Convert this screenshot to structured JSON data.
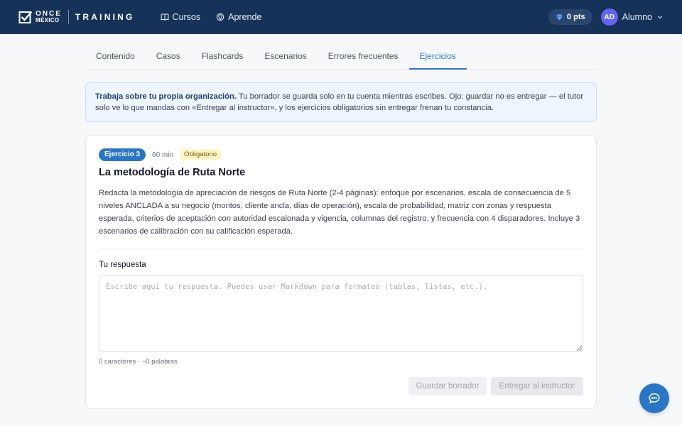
{
  "header": {
    "logo_top": "ONCE",
    "logo_bottom": "MÉXICO",
    "brand": "TRAINING",
    "nav": [
      {
        "label": "Cursos",
        "icon": "book-open-icon"
      },
      {
        "label": "Aprende",
        "icon": "lightbulb-icon"
      }
    ],
    "points": "0 pts",
    "avatar_initials": "AD",
    "user_name": "Alumno"
  },
  "tabs": [
    {
      "label": "Contenido",
      "active": false
    },
    {
      "label": "Casos",
      "active": false
    },
    {
      "label": "Flashcards",
      "active": false
    },
    {
      "label": "Escenarios",
      "active": false
    },
    {
      "label": "Errores frecuentes",
      "active": false
    },
    {
      "label": "Ejercicios",
      "active": true
    }
  ],
  "notice": {
    "bold": "Trabaja sobre tu propia organización.",
    "text": " Tu borrador se guarda solo en tu cuenta mientras escribes. Ojo: guardar no es entregar — el tutor solo ve lo que mandas con «Entregar al instructor», y los ejercicios obligatorios sin entregar frenan tu constancia."
  },
  "exercise": {
    "badge": "Ejercicio 3",
    "duration": "60 min",
    "required": "Obligatorio",
    "title": "La metodología de Ruta Norte",
    "description": "Redacta la metodología de apreciación de riesgos de Ruta Norte (2-4 páginas): enfoque por escenarios, escala de consecuencia de 5 niveles ANCLADA a su negocio (montos, cliente ancla, días de operación), escala de probabilidad, matriz con zonas y respuesta esperada, criterios de aceptación con autoridad escalonada y vigencia, columnas del registro, y frecuencia con 4 disparadores. Incluye 3 escenarios de calibración con su calificación esperada."
  },
  "response": {
    "label": "Tu respuesta",
    "value": "",
    "placeholder": "Escribe aquí tu respuesta. Puedes usar Markdown para formateo (tablas, listas, etc.).",
    "counter": "0 caracteres · ~0 palabras"
  },
  "buttons": {
    "save_draft": "Guardar borrador",
    "submit": "Entregar al instructor"
  },
  "colors": {
    "header_bg": "#163258",
    "accent": "#2b76c4",
    "avatar_bg": "#6366f1",
    "required_badge_bg": "#fdf6c8"
  }
}
